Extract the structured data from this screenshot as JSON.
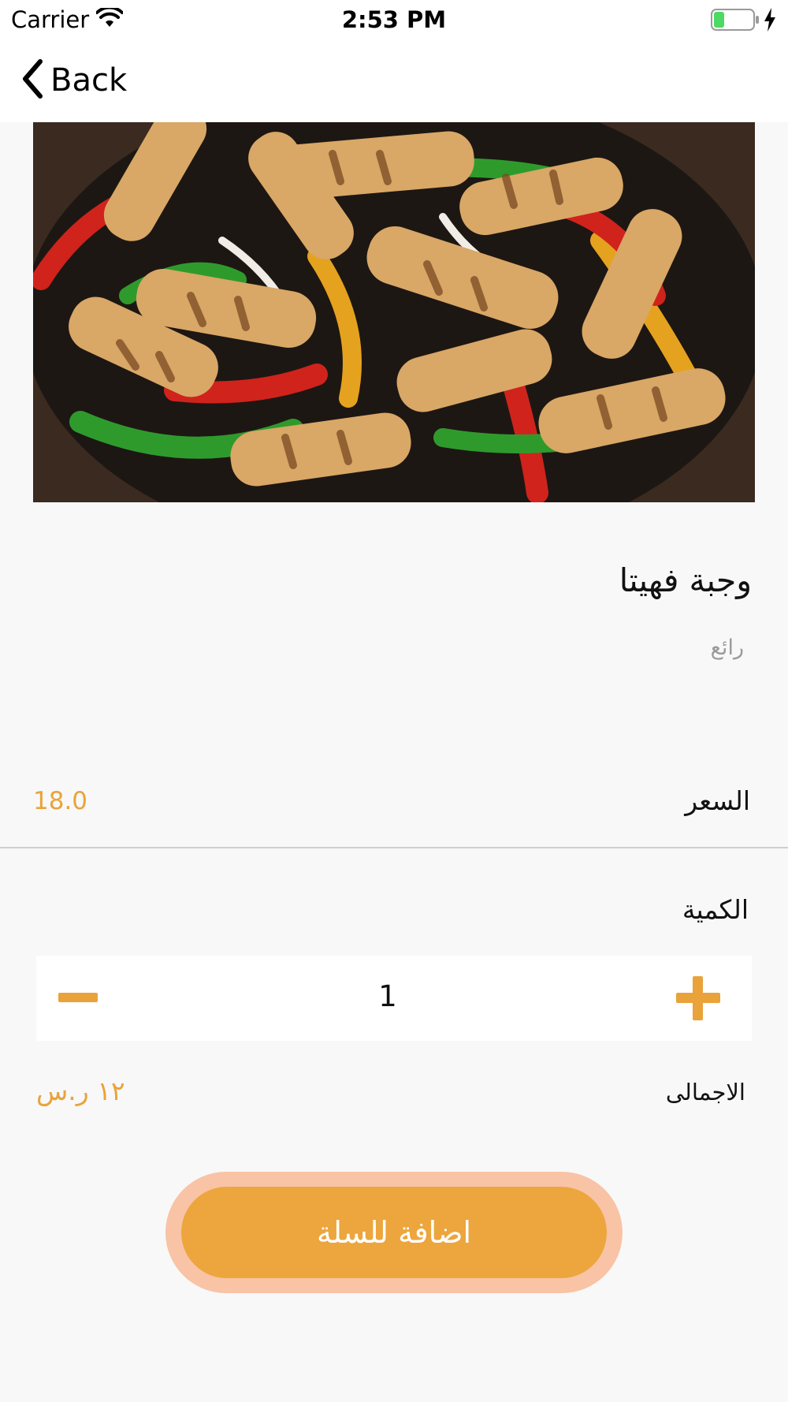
{
  "status_bar": {
    "carrier": "Carrier",
    "time": "2:53 PM",
    "battery_color": "#4cd964",
    "icons": [
      "wifi-icon",
      "battery-icon",
      "charging-bolt-icon"
    ]
  },
  "nav": {
    "back_label": "Back",
    "back_icon": "chevron-left-icon"
  },
  "product": {
    "image": "grilled chicken fajita with peppers",
    "name": "وجبة فهيتا",
    "description": "رائع",
    "price_label": "السعر",
    "price_value": "18.0"
  },
  "quantity": {
    "label": "الكمية",
    "value": "1",
    "decrement_icon": "minus-icon",
    "increment_icon": "plus-icon"
  },
  "total": {
    "label": "الاجمالى",
    "value": "١٢ ر.س"
  },
  "actions": {
    "add_to_cart_label": "اضافة للسلة"
  },
  "colors": {
    "accent": "#e9a33a",
    "button": "#eca63d",
    "button_halo": "#f9c3a5",
    "background": "#f8f8f8"
  }
}
